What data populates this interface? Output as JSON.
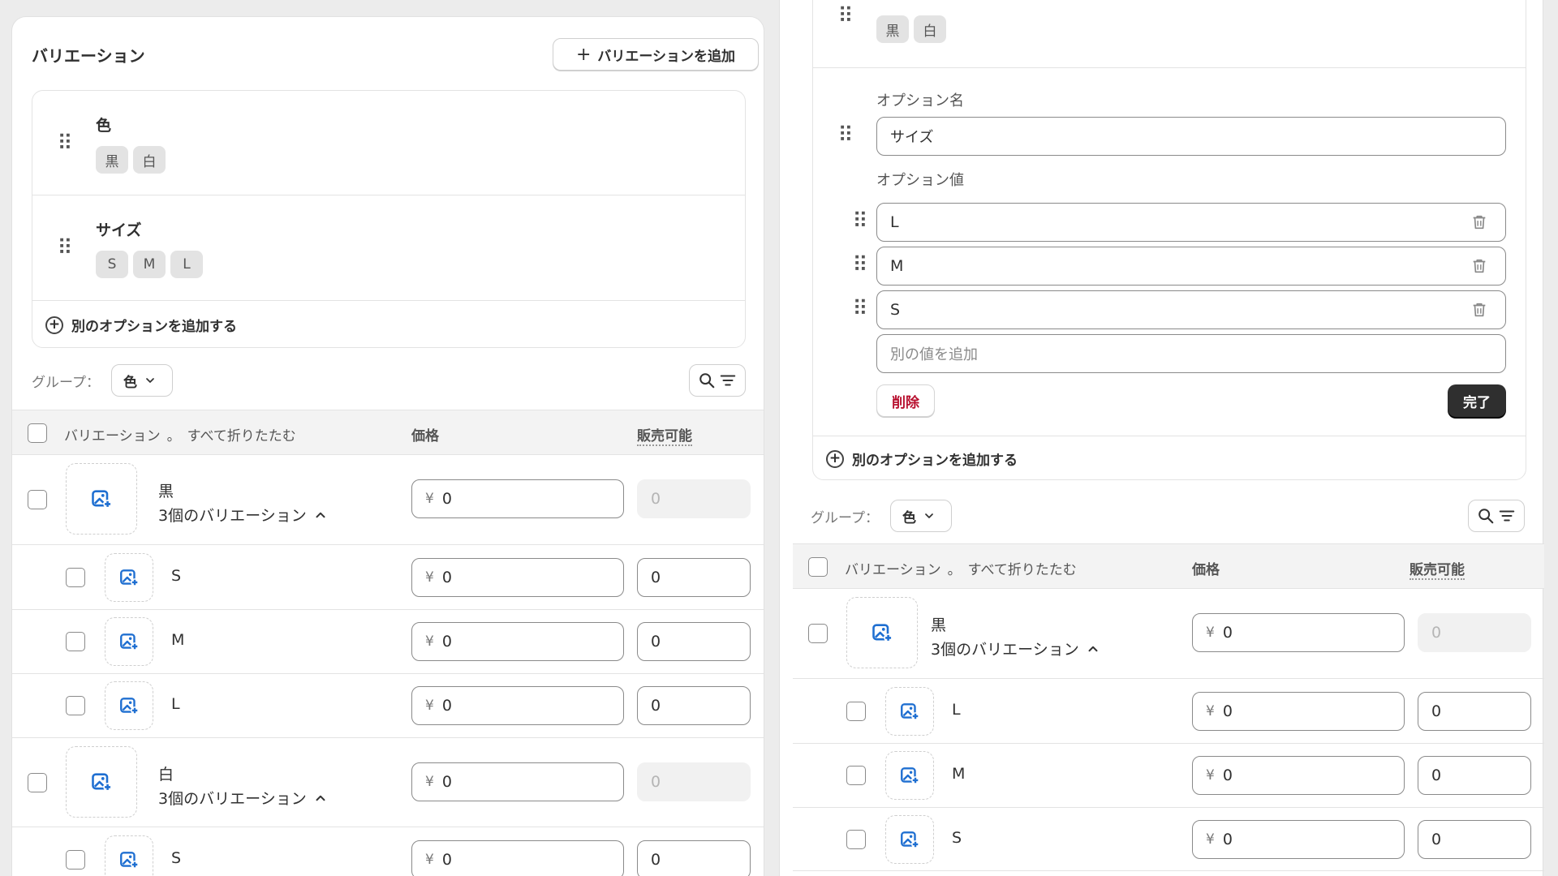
{
  "left": {
    "title": "バリエーション",
    "add_variant_label": "バリエーションを追加",
    "options": [
      {
        "name": "色",
        "values": [
          "黒",
          "白"
        ]
      },
      {
        "name": "サイズ",
        "values": [
          "S",
          "M",
          "L"
        ]
      }
    ],
    "add_option_label": "別のオプションを追加する",
    "group_label": "グループ：",
    "group_value": "色",
    "table": {
      "col_variant": "バリエーション",
      "col_sep": "。",
      "col_collapse": "すべて折りたたむ",
      "col_price": "価格",
      "col_available": "販売可能"
    },
    "groups": [
      {
        "name": "黒",
        "count_label": "3個のバリエーション",
        "price": "0",
        "available": "0",
        "children": [
          {
            "name": "S",
            "price": "0",
            "available": "0"
          },
          {
            "name": "M",
            "price": "0",
            "available": "0"
          },
          {
            "name": "L",
            "price": "0",
            "available": "0"
          }
        ]
      },
      {
        "name": "白",
        "count_label": "3個のバリエーション",
        "price": "0",
        "available": "0",
        "children": [
          {
            "name": "S",
            "price": "0",
            "available": "0"
          }
        ]
      }
    ]
  },
  "right": {
    "option_color_values": [
      "黒",
      "白"
    ],
    "option_name_label": "オプション名",
    "option_name_value": "サイズ",
    "option_values_label": "オプション値",
    "option_values": [
      "L",
      "M",
      "S"
    ],
    "add_value_placeholder": "別の値を追加",
    "delete_label": "削除",
    "done_label": "完了",
    "add_option_label": "別のオプションを追加する",
    "group_label": "グループ：",
    "group_value": "色",
    "table": {
      "col_variant": "バリエーション",
      "col_sep": "。",
      "col_collapse": "すべて折りたたむ",
      "col_price": "価格",
      "col_available": "販売可能"
    },
    "group": {
      "name": "黒",
      "count_label": "3個のバリエーション",
      "price": "0",
      "available": "0",
      "children": [
        {
          "name": "L",
          "price": "0",
          "available": "0"
        },
        {
          "name": "M",
          "price": "0",
          "available": "0"
        },
        {
          "name": "S",
          "price": "0",
          "available": "0"
        }
      ]
    }
  },
  "currency_symbol": "¥",
  "colors": {
    "accent_icon": "#1f6fd1",
    "danger": "#b8102f",
    "dark_button": "#2f2f2f"
  },
  "icons": [
    "drag-handle-icon",
    "plus-icon",
    "plus-circle-icon",
    "chevron-down-icon",
    "chevron-up-icon",
    "search-icon",
    "filter-icon",
    "image-add-icon",
    "trash-icon"
  ]
}
